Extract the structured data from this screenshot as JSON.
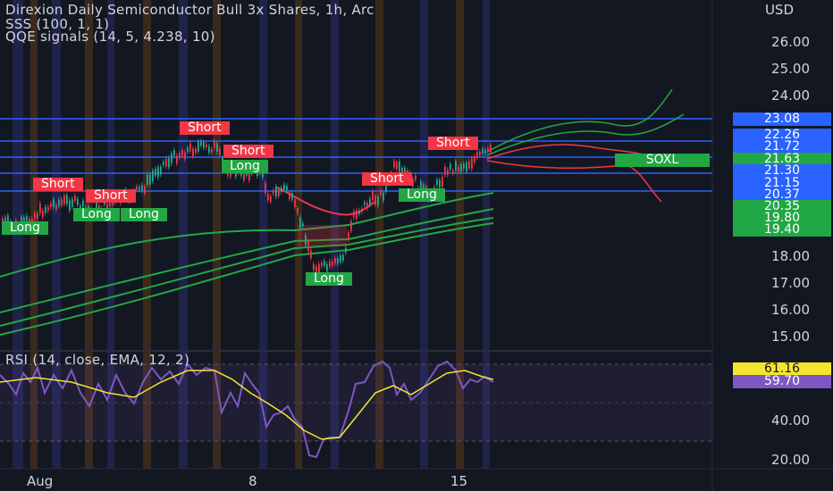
{
  "header": {
    "title": "Direxion Daily Semiconductor Bull 3x Shares, 1h, Arc",
    "indicator1": "SSS (100, 1, 1)",
    "indicator2": "QQE signals (14, 5, 4.238, 10)",
    "rsi_title": "RSI (14, close, EMA, 12, 2)"
  },
  "price_axis": {
    "currency": "USD",
    "ticks": [
      "26.00",
      "25.00",
      "24.00",
      "18.00",
      "17.00",
      "16.00",
      "15.00"
    ],
    "markers": [
      {
        "label": "23.08",
        "color": "#2962ff"
      },
      {
        "label": "22.26",
        "color": "#2962ff"
      },
      {
        "label": "21.72",
        "color": "#2962ff"
      },
      {
        "label": "21.63",
        "color": "#22a745"
      },
      {
        "label": "21.30",
        "color": "#2962ff"
      },
      {
        "label": "21.15",
        "color": "#2962ff"
      },
      {
        "label": "20.37",
        "color": "#2962ff"
      },
      {
        "label": "20.35",
        "color": "#22a745"
      },
      {
        "label": "19.80",
        "color": "#22a745"
      },
      {
        "label": "19.40",
        "color": "#22a745"
      }
    ]
  },
  "rsi_axis": {
    "ticks": [
      "40.00",
      "20.00"
    ],
    "markers": [
      {
        "label": "61.16",
        "color": "#f5e52c"
      },
      {
        "label": "59.70",
        "color": "#7e57c2"
      }
    ]
  },
  "time_axis": {
    "labels": [
      "Aug",
      "8",
      "15"
    ]
  },
  "signals": [
    {
      "text": "Short",
      "type": "short"
    },
    {
      "text": "Short",
      "type": "short"
    },
    {
      "text": "Short",
      "type": "short"
    },
    {
      "text": "Short",
      "type": "short"
    },
    {
      "text": "Short",
      "type": "short"
    },
    {
      "text": "Long",
      "type": "long"
    },
    {
      "text": "Long",
      "type": "long"
    },
    {
      "text": "Long",
      "type": "long"
    },
    {
      "text": "Long",
      "type": "long"
    },
    {
      "text": "Long",
      "type": "long"
    },
    {
      "text": "Long",
      "type": "long"
    }
  ],
  "symbol_tag": "SOXL",
  "colors": {
    "background": "#131722",
    "up": "#22ab94",
    "down": "#f23645",
    "level_line": "#2962ff",
    "rsi_line": "#7e57c2",
    "rsi_ma": "#f5e52c"
  }
}
